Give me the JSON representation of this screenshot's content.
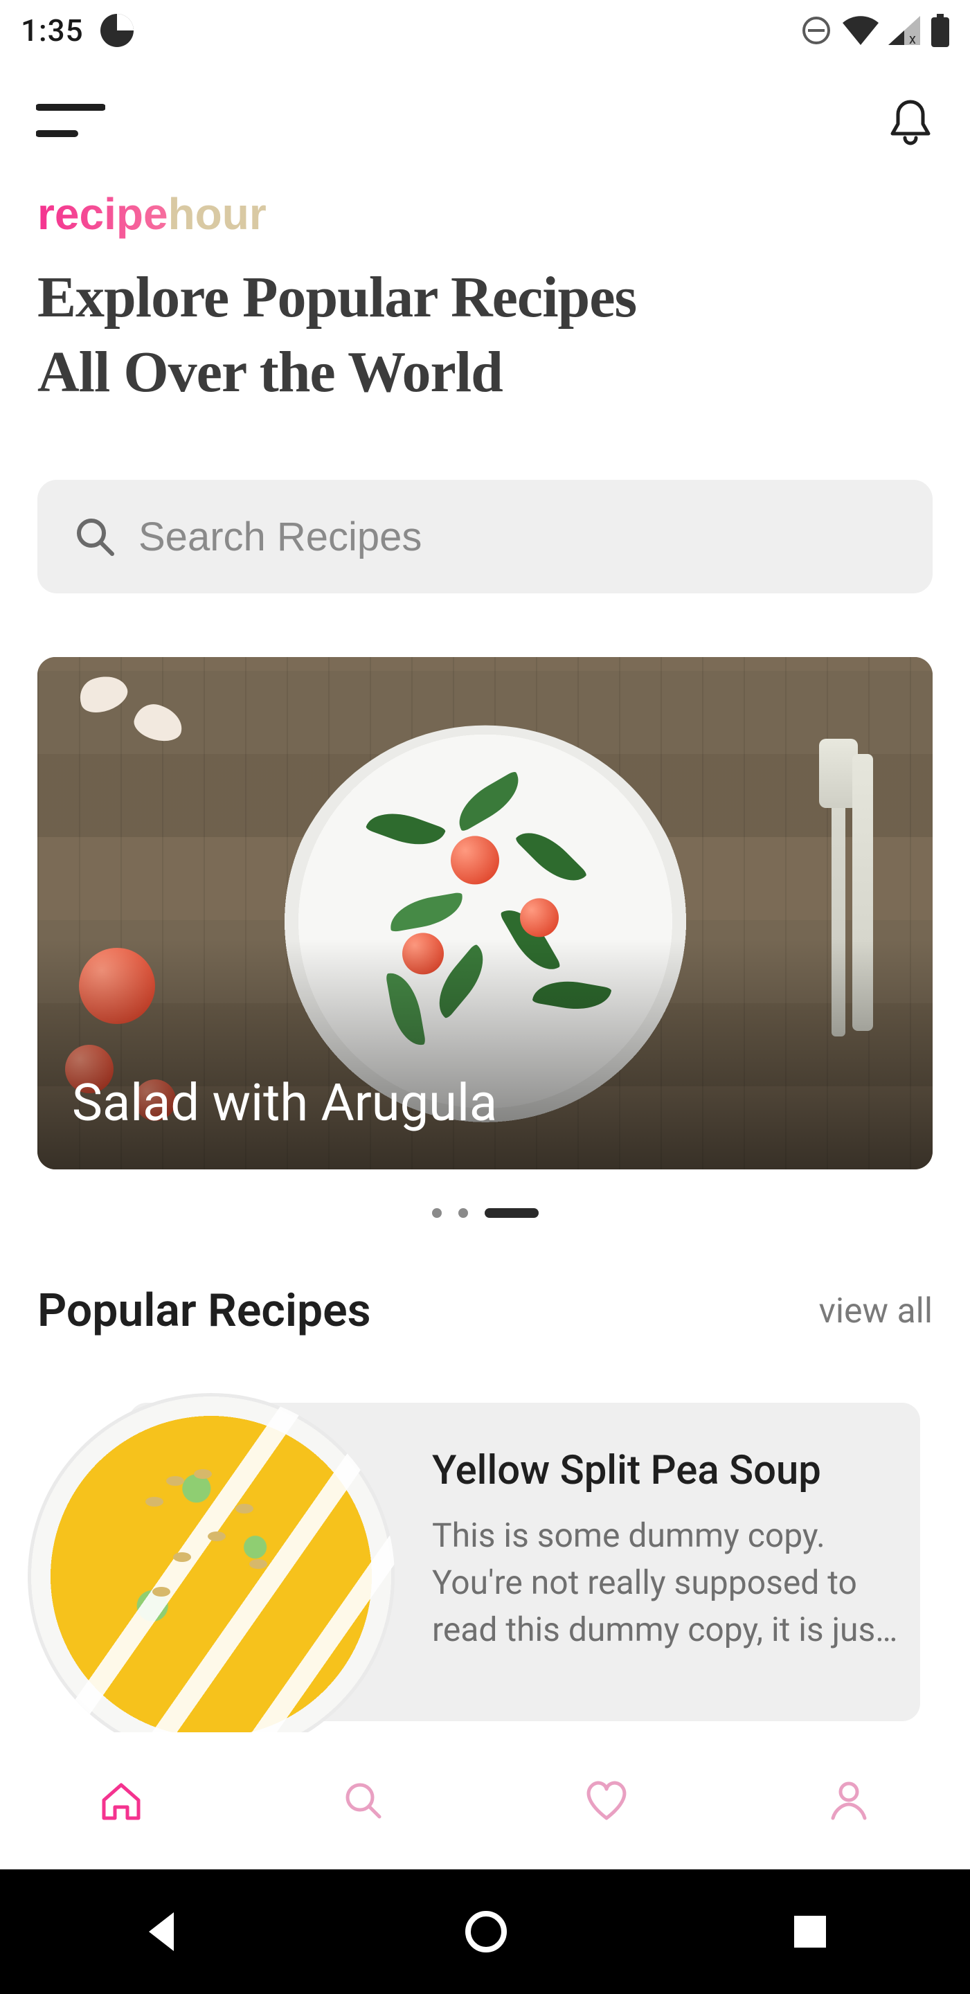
{
  "status": {
    "time": "1:35"
  },
  "header": {
    "logo_part1": "recipe",
    "logo_part2": "hour",
    "headline": "Explore Popular Recipes\nAll Over the World"
  },
  "search": {
    "placeholder": "Search Recipes",
    "value": ""
  },
  "hero": {
    "title": "Salad with Arugula",
    "active_index": 2,
    "count": 3
  },
  "popular": {
    "section_title": "Popular Recipes",
    "view_all_label": "view all",
    "items": [
      {
        "title": "Yellow Split Pea Soup",
        "description": "This is some dummy copy. You're not really supposed to read this dummy copy, it is jus…"
      }
    ]
  },
  "bottom_nav": {
    "items": [
      "home",
      "search",
      "favorites",
      "profile"
    ],
    "active": "home"
  },
  "colors": {
    "brand_pink": "#f4338f",
    "brand_gold": "#d9c9a3",
    "nav_active": "#f4338f",
    "nav_inactive": "#e9a0c2"
  }
}
